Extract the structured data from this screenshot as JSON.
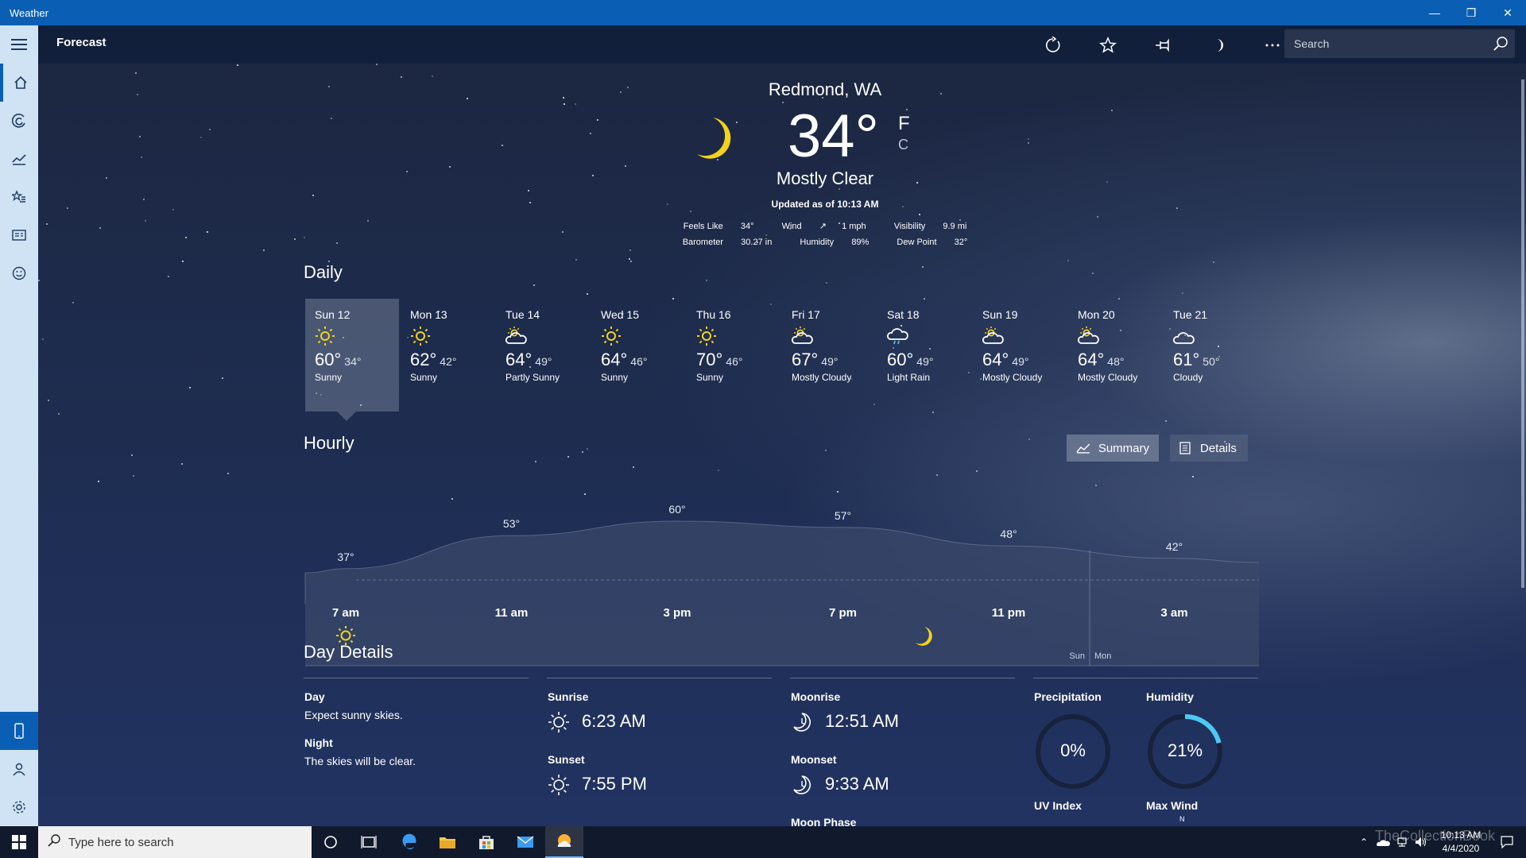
{
  "window": {
    "title": "Weather"
  },
  "appbar": {
    "title": "Forecast",
    "search_placeholder": "Search"
  },
  "current": {
    "location": "Redmond, WA",
    "temp": "34°",
    "unit_f": "F",
    "unit_c": "C",
    "condition": "Mostly Clear",
    "updated": "Updated as of 10:13 AM",
    "feels_like_label": "Feels Like",
    "feels_like": "34°",
    "wind_label": "Wind",
    "wind": "1 mph",
    "visibility_label": "Visibility",
    "visibility": "9.9 mi",
    "barometer_label": "Barometer",
    "barometer": "30.27 in",
    "humidity_label": "Humidity",
    "humidity": "89%",
    "dewpoint_label": "Dew Point",
    "dewpoint": "32°"
  },
  "daily": {
    "heading": "Daily",
    "days": [
      {
        "name": "Sun 12",
        "hi": "60°",
        "lo": "34°",
        "cond": "Sunny",
        "icon": "sun-icon"
      },
      {
        "name": "Mon 13",
        "hi": "62°",
        "lo": "42°",
        "cond": "Sunny",
        "icon": "sun-icon"
      },
      {
        "name": "Tue 14",
        "hi": "64°",
        "lo": "49°",
        "cond": "Partly Sunny",
        "icon": "partly-sunny-icon"
      },
      {
        "name": "Wed 15",
        "hi": "64°",
        "lo": "46°",
        "cond": "Sunny",
        "icon": "sun-icon"
      },
      {
        "name": "Thu 16",
        "hi": "70°",
        "lo": "46°",
        "cond": "Sunny",
        "icon": "sun-icon"
      },
      {
        "name": "Fri 17",
        "hi": "67°",
        "lo": "49°",
        "cond": "Mostly Cloudy",
        "icon": "mostly-cloudy-icon"
      },
      {
        "name": "Sat 18",
        "hi": "60°",
        "lo": "49°",
        "cond": "Light Rain",
        "icon": "light-rain-icon"
      },
      {
        "name": "Sun 19",
        "hi": "64°",
        "lo": "49°",
        "cond": "Mostly Cloudy",
        "icon": "mostly-cloudy-icon"
      },
      {
        "name": "Mon 20",
        "hi": "64°",
        "lo": "48°",
        "cond": "Mostly Cloudy",
        "icon": "mostly-cloudy-icon"
      },
      {
        "name": "Tue 21",
        "hi": "61°",
        "lo": "50°",
        "cond": "Cloudy",
        "icon": "cloudy-icon"
      }
    ]
  },
  "hourly": {
    "heading": "Hourly",
    "summary_label": "Summary",
    "details_label": "Details",
    "day_divider": [
      "Sun",
      "Mon"
    ],
    "hour_labels": [
      "7 am",
      "11 am",
      "3 pm",
      "7 pm",
      "11 pm",
      "3 am"
    ],
    "temp_labels": [
      "37°",
      "53°",
      "60°",
      "57°",
      "48°",
      "42°"
    ]
  },
  "chart_data": {
    "type": "area",
    "x": [
      "7 am",
      "11 am",
      "3 pm",
      "7 pm",
      "11 pm",
      "3 am"
    ],
    "series": [
      {
        "values": [
          37,
          53,
          60,
          57,
          48,
          42
        ]
      }
    ]
  },
  "day_details": {
    "heading": "Day Details",
    "day_label": "Day",
    "day_text": "Expect sunny skies.",
    "night_label": "Night",
    "night_text": "The skies will be clear.",
    "sunrise_label": "Sunrise",
    "sunrise": "6:23 AM",
    "sunset_label": "Sunset",
    "sunset": "7:55 PM",
    "moonrise_label": "Moonrise",
    "moonrise": "12:51 AM",
    "moonset_label": "Moonset",
    "moonset": "9:33 AM",
    "moonphase_label": "Moon Phase",
    "precip_label": "Precipitation",
    "precip": "0%",
    "precip_value": 0,
    "humidity_label": "Humidity",
    "humidity": "21%",
    "humidity_value": 21,
    "uv_label": "UV Index",
    "maxwind_label": "Max Wind",
    "maxwind_dir": "N"
  },
  "taskbar": {
    "search_placeholder": "Type here to search",
    "time": "10:13 AM",
    "date": "4/4/2020"
  },
  "watermark": "TheCollectionBook",
  "colors": {
    "titlebar": "#0a5fb4",
    "accent_gauge": "#4cc9f0",
    "sun": "#f2d21b",
    "rail": "#cfe3f5"
  }
}
